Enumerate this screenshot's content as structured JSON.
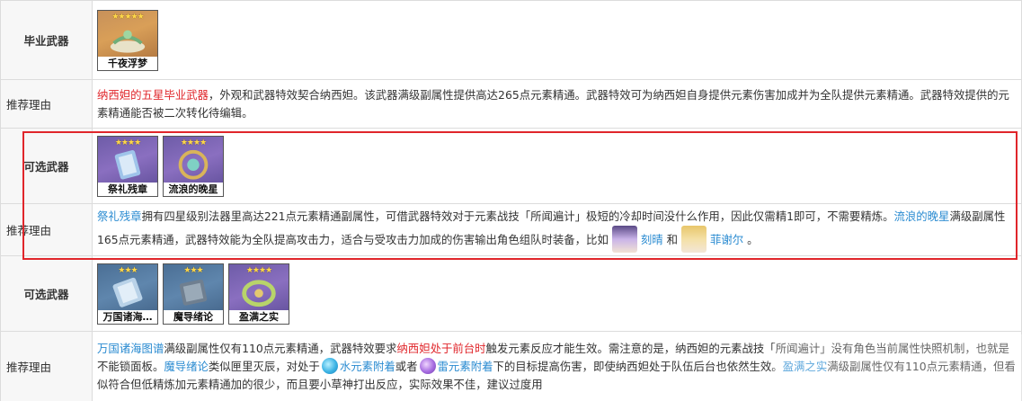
{
  "rows": {
    "best_weapon": {
      "label": "毕业武器",
      "cards": [
        {
          "name": "千夜浮梦",
          "stars": "★★★★★"
        }
      ]
    },
    "best_reason": {
      "label": "推荐理由",
      "highlight": "纳西妲的五星毕业武器",
      "text": "，外观和武器特效契合纳西妲。该武器满级副属性提供高达265点元素精通。武器特效可为纳西妲自身提供元素伤害加成并为全队提供元素精通。武器特效提供的元素精通能否被二次转化待编辑。"
    },
    "alt_weapon_1": {
      "label": "可选武器",
      "cards": [
        {
          "name": "祭礼残章",
          "stars": "★★★★"
        },
        {
          "name": "流浪的晚星",
          "stars": "★★★★"
        }
      ]
    },
    "alt_reason_1": {
      "label": "推荐理由",
      "link1": "祭礼残章",
      "text1": "拥有四星级别法器里高达221点元素精通副属性，可借武器特效对于元素战技「所闻遍计」极短的冷却时间没什么作用，因此仅需精1即可，不需要精炼。",
      "link2": "流浪的晚星",
      "text2": "满级副属性165点元素精通，武器特效能为全队提高攻击力，适合与受攻击力加成的伤害输出角色组队时装备，比如",
      "char1": "刻晴",
      "and": "和",
      "char2": "菲谢尔",
      "end": "。"
    },
    "alt_weapon_2": {
      "label": "可选武器",
      "cards": [
        {
          "name": "万国诸海…",
          "stars": "★★★"
        },
        {
          "name": "魔导绪论",
          "stars": "★★★"
        },
        {
          "name": "盈满之实",
          "stars": "★★★★"
        }
      ]
    },
    "alt_reason_2": {
      "label": "推荐理由",
      "link1": "万国诸海图谱",
      "text1": "满级副属性仅有110点元素精通，武器特效要求",
      "red1": "纳西妲处于前台时",
      "text2": "触发元素反应才能生效。需注意的是，纳西妲的元素战技「所闻遍计」没有角色当前属性快照机制，也就是不能锁面板。",
      "link2": "魔导绪论",
      "text3": "类似匣里灭辰，对处于",
      "hydro": "水元素附着",
      "or": "或者",
      "electro": "雷元素附着",
      "text4": "下的目标提高伤害，即使纳西妲处于队伍后台也依然生效。",
      "link3": "盈满之实",
      "text5": "满级副属性仅有110点元素精通",
      "text6": "，但看似符合但低精炼加元素精通加的很少，而且要小草神打出反应，实际效果不佳，建议过度用"
    }
  }
}
